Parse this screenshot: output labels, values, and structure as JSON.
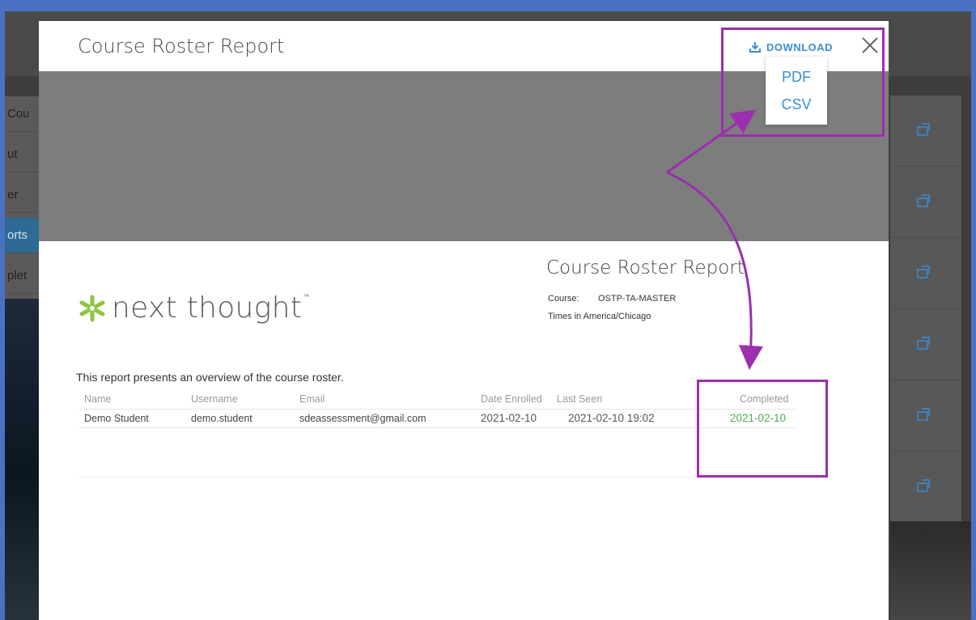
{
  "background": {
    "left_menu": [
      {
        "label": "Cou",
        "active": false
      },
      {
        "label": "ut",
        "active": false
      },
      {
        "label": "er",
        "active": false
      },
      {
        "label": "orts",
        "active": true
      },
      {
        "label": "plet",
        "active": false
      }
    ],
    "right_action_icon": "open-external-icon",
    "right_action_count": 6
  },
  "modal": {
    "title": "Course Roster Report",
    "download_label": "DOWNLOAD",
    "download_icon": "download-icon",
    "close_icon": "close-icon",
    "download_menu": [
      "PDF",
      "CSV"
    ]
  },
  "report": {
    "logo_text": "next thought",
    "logo_tm": "™",
    "title": "Course Roster Report",
    "course_label": "Course:",
    "course_value": "OSTP-TA-MASTER",
    "timezone": "Times in America/Chicago",
    "intro": "This report presents an overview of the course roster.",
    "columns": [
      "Name",
      "Username",
      "Email",
      "Date Enrolled",
      "Last Seen",
      "Completed"
    ],
    "rows": [
      {
        "name": "Demo Student",
        "username": "demo.student",
        "email": "sdeassessment@gmail.com",
        "date_enrolled": "2021-02-10",
        "last_seen": "2021-02-10 19:02",
        "completed": "2021-02-10"
      }
    ]
  },
  "colors": {
    "accent": "#3a8fd5",
    "annotation": "#9b2fae",
    "completed_green": "#4caf50",
    "page_border": "#4a72c4"
  }
}
